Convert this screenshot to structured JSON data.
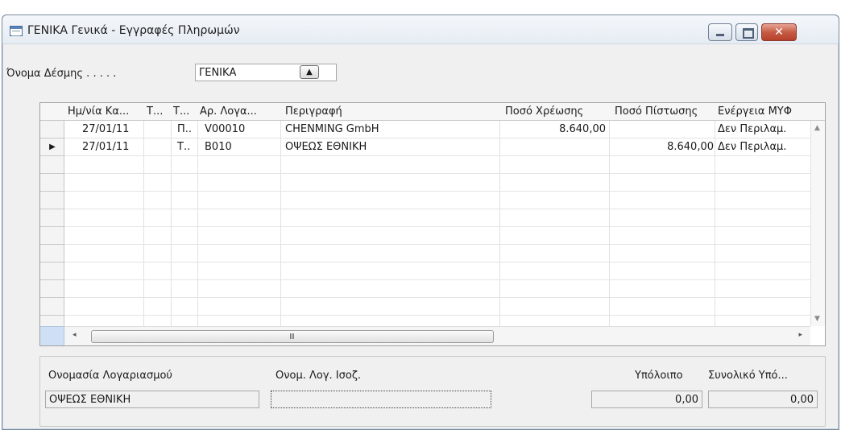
{
  "window": {
    "title": "ΓΕΝΙΚΑ Γενικά - Εγγραφές Πληρωμών",
    "close_glyph": "✕"
  },
  "batch": {
    "label": "Όνομα Δέσμης . . . . .",
    "value": "ΓΕΝΙΚΑ",
    "lookup_glyph": "▲"
  },
  "grid": {
    "headers": [
      "Ημ/νία Κα...",
      "Τ...",
      "Τ...",
      "Αρ. Λογα...",
      "Περιγραφή",
      "Ποσό Χρέωσης",
      "Ποσό Πίστωσης",
      "Ενέργεια ΜΥΦ"
    ],
    "rows": [
      {
        "date": "27/01/11",
        "t1": "",
        "t2": "Π..",
        "account": "V00010",
        "description": "CHENMING GmbH",
        "debit": "8.640,00",
        "credit": "",
        "myf": "Δεν Περιλαμ."
      },
      {
        "date": "27/01/11",
        "t1": "",
        "t2": "Τ..",
        "account": "B010",
        "description": "ΟΨΕΩΣ ΕΘΝΙΚΗ",
        "debit": "",
        "credit": "8.640,00",
        "myf": "Δεν Περιλαμ."
      }
    ],
    "current_row_marker": "▶",
    "scroll_left": "◂",
    "scroll_right": "▸",
    "scroll_up": "▲",
    "scroll_down": "▼",
    "scroll_grip": "III"
  },
  "footer": {
    "account_name_label": "Ονομασία Λογαριασμού",
    "account_name_value": "ΟΨΕΩΣ ΕΘΝΙΚΗ",
    "balance_account_label": "Ονομ. Λογ. Ισοζ.",
    "balance_account_value": "",
    "balance_label": "Υπόλοιπο",
    "balance_value": "0,00",
    "total_balance_label": "Συνολικό Υπό...",
    "total_balance_value": "0,00"
  },
  "colors": {
    "selector_blue": "#cfe0f4",
    "close_red": "#c65b44"
  }
}
